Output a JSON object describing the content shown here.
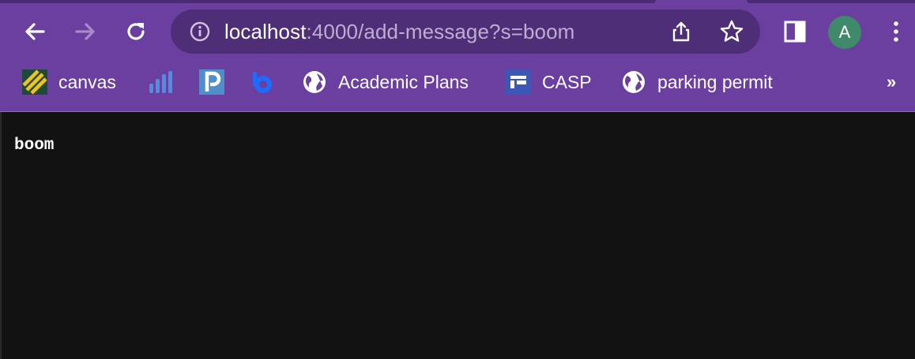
{
  "nav": {
    "back_icon": "arrow-left-icon",
    "forward_icon": "arrow-right-icon",
    "reload_icon": "reload-icon"
  },
  "omnibox": {
    "info_icon": "info-icon",
    "url_host": "localhost",
    "url_rest": ":4000/add-message?s=boom",
    "share_icon": "share-icon",
    "bookmark_star_icon": "star-icon"
  },
  "toolbar": {
    "sidepanel_icon": "side-panel-icon",
    "avatar_initial": "A",
    "menu_icon": "kebab-menu-icon"
  },
  "bookmarks": {
    "items": [
      {
        "label": "canvas",
        "icon": "canvas-icon"
      },
      {
        "label": "",
        "icon": "bar-graph-icon"
      },
      {
        "label": "",
        "icon": "p-logo-icon"
      },
      {
        "label": "",
        "icon": "b-logo-icon"
      },
      {
        "label": "Academic Plans",
        "icon": "globe-icon"
      },
      {
        "label": "CASP",
        "icon": "casp-icon"
      },
      {
        "label": "parking permit",
        "icon": "globe-icon"
      }
    ],
    "overflow": "»"
  },
  "page": {
    "message": "boom"
  },
  "colors": {
    "chrome": "#6b3fa0",
    "omnibox": "#4f2e78",
    "page_bg": "#121212",
    "avatar": "#3f8a6b"
  }
}
